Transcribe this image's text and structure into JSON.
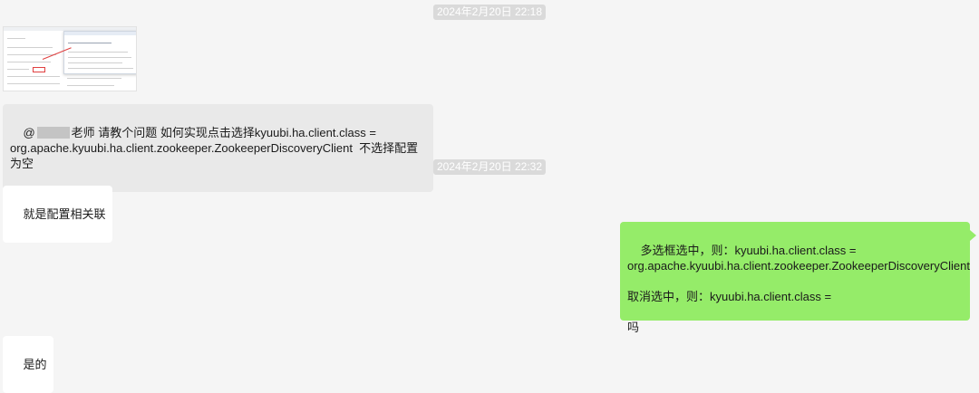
{
  "messages": {
    "timestamp1": "2024年2月20日 22:18",
    "image_label": "screenshot-thumbnail",
    "msg1_prefix": "@",
    "msg1_body": "老师 请教个问题 如何实现点击选择kyuubi.ha.client.class = org.apache.kyuubi.ha.client.zookeeper.ZookeeperDiscoveryClient  不选择配置为空",
    "timestamp2": "2024年2月20日 22:32",
    "msg2": "就是配置相关联",
    "msg3": "多选框选中，则：kyuubi.ha.client.class = org.apache.kyuubi.ha.client.zookeeper.ZookeeperDiscoveryClient\n\n取消选中，则：kyuubi.ha.client.class =\n\n吗",
    "msg4": "是的"
  },
  "colors": {
    "background": "#f5f5f5",
    "incoming_gray": "#e9e9e9",
    "incoming_white": "#ffffff",
    "outgoing_green": "#95ec69",
    "timestamp_bg": "#dadada"
  }
}
